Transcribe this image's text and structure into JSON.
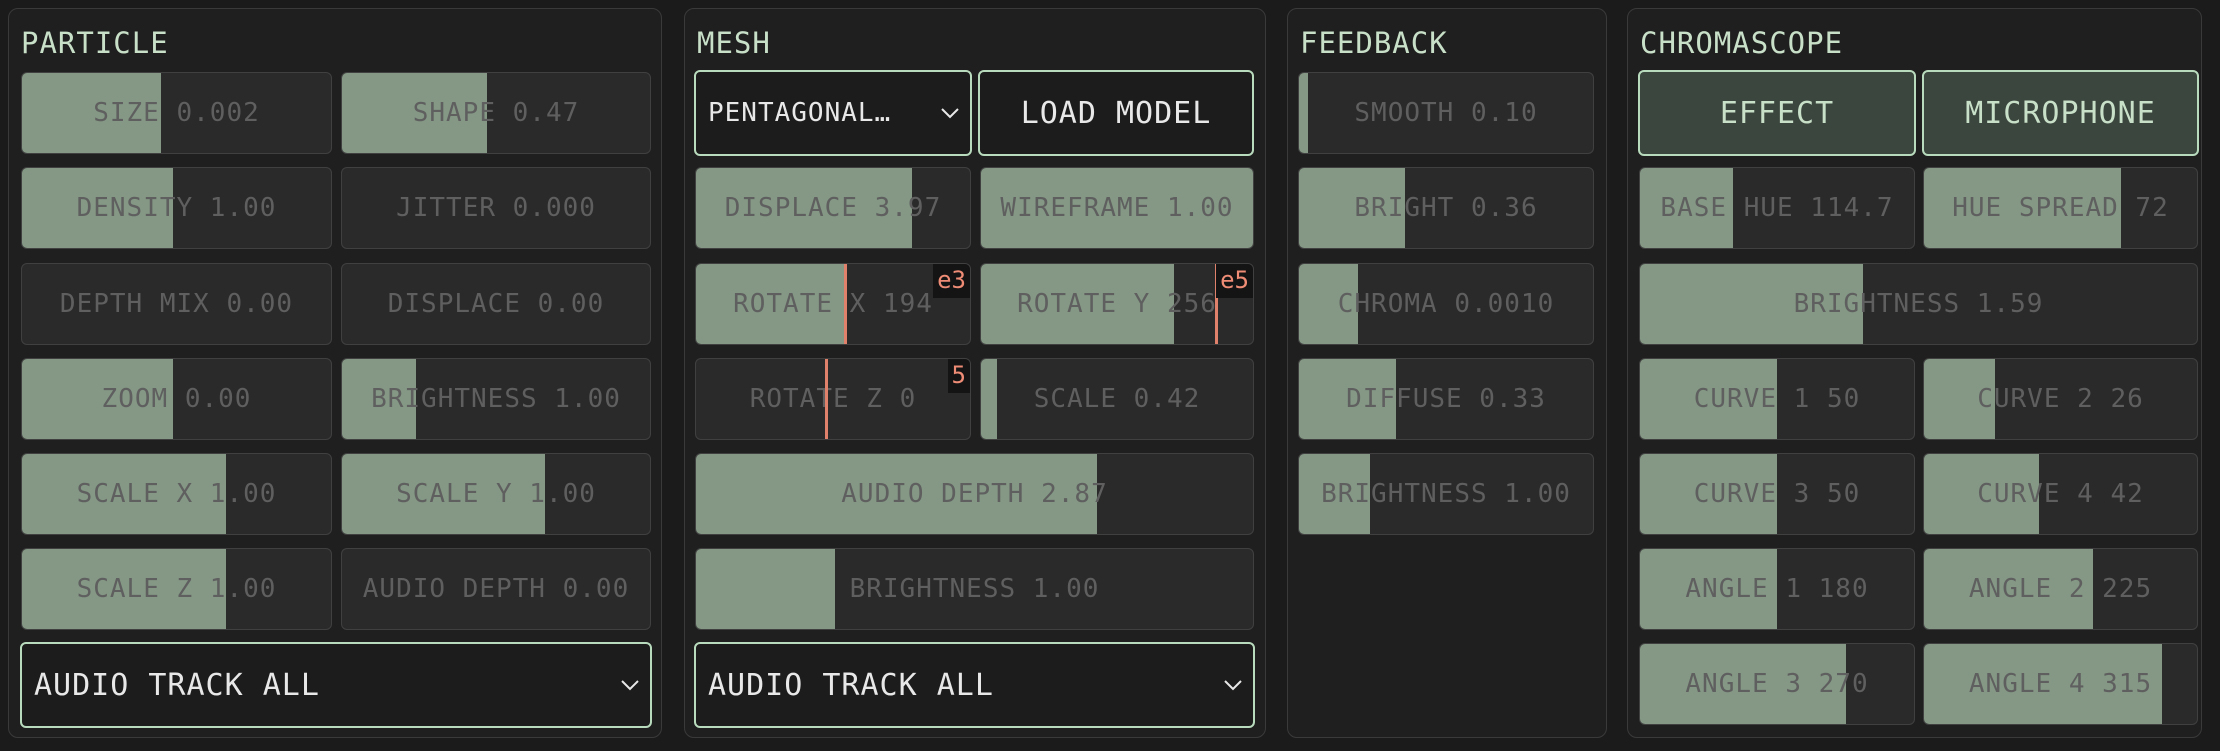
{
  "particle": {
    "title": "PARTICLE",
    "sliders": [
      {
        "label": "SIZE 0.002",
        "value": 0.45
      },
      {
        "label": "SHAPE 0.47",
        "value": 0.47
      },
      {
        "label": "DENSITY 1.00",
        "value": 0.49
      },
      {
        "label": "JITTER 0.000",
        "value": 0.0
      },
      {
        "label": "DEPTH MIX 0.00",
        "value": 0.0
      },
      {
        "label": "DISPLACE 0.00",
        "value": 0.0
      },
      {
        "label": "ZOOM 0.00",
        "value": 0.49
      },
      {
        "label": "BRIGHTNESS 1.00",
        "value": 0.24
      },
      {
        "label": "SCALE X 1.00",
        "value": 0.66
      },
      {
        "label": "SCALE Y 1.00",
        "value": 0.66
      },
      {
        "label": "SCALE Z 1.00",
        "value": 0.66
      },
      {
        "label": "AUDIO DEPTH 0.00",
        "value": 0.0
      }
    ],
    "audio_track": "AUDIO TRACK ALL"
  },
  "mesh": {
    "title": "MESH",
    "model_select": "PENTAGONAL…",
    "load_button": "LOAD MODEL",
    "sliders": [
      {
        "label": "DISPLACE 3.97",
        "value": 0.79
      },
      {
        "label": "WIREFRAME 1.00",
        "value": 1.0
      },
      {
        "label": "ROTATE X 194",
        "value": 0.54,
        "marker": 0.54,
        "exponent": "e3"
      },
      {
        "label": "ROTATE Y 256",
        "value": 0.71,
        "marker": 0.86,
        "exponent": "e5"
      },
      {
        "label": "ROTATE Z 0",
        "value": 0.0,
        "marker": 0.47,
        "exponent": "5"
      },
      {
        "label": "SCALE 0.42",
        "value": 0.06
      },
      {
        "label": "AUDIO DEPTH 2.87",
        "value": 0.72
      },
      {
        "label": "BRIGHTNESS 1.00",
        "value": 0.25
      }
    ],
    "audio_track": "AUDIO TRACK ALL"
  },
  "feedback": {
    "title": "FEEDBACK",
    "sliders": [
      {
        "label": "SMOOTH 0.10",
        "value": 0.03
      },
      {
        "label": "BRIGHT 0.36",
        "value": 0.36
      },
      {
        "label": "CHROMA 0.0010",
        "value": 0.2
      },
      {
        "label": "DIFFUSE 0.33",
        "value": 0.33
      },
      {
        "label": "BRIGHTNESS 1.00",
        "value": 0.24
      }
    ]
  },
  "chromascope": {
    "title": "CHROMASCOPE",
    "effect_button": "EFFECT",
    "microphone_button": "MICROPHONE",
    "sliders": [
      {
        "label": "BASE HUE 114.7",
        "value": 0.34
      },
      {
        "label": "HUE SPREAD 72",
        "value": 0.72
      },
      {
        "label": "BRIGHTNESS 1.59",
        "value": 0.4
      },
      {
        "label": "CURVE 1 50",
        "value": 0.5
      },
      {
        "label": "CURVE 2 26",
        "value": 0.26
      },
      {
        "label": "CURVE 3 50",
        "value": 0.5
      },
      {
        "label": "CURVE 4 42",
        "value": 0.42
      },
      {
        "label": "ANGLE 1 180",
        "value": 0.5
      },
      {
        "label": "ANGLE 2 225",
        "value": 0.62
      },
      {
        "label": "ANGLE 3 270",
        "value": 0.75
      },
      {
        "label": "ANGLE 4 315",
        "value": 0.87
      }
    ]
  },
  "colors": {
    "background": "#1b1b1b",
    "panel": "#1f1f1f",
    "slider_fill": "#849885",
    "accent_border": "#b9dbbd",
    "title_text": "#c8dfc8",
    "marker": "#e0816c"
  },
  "icons": {
    "dropdown": "chevron-down-icon"
  }
}
